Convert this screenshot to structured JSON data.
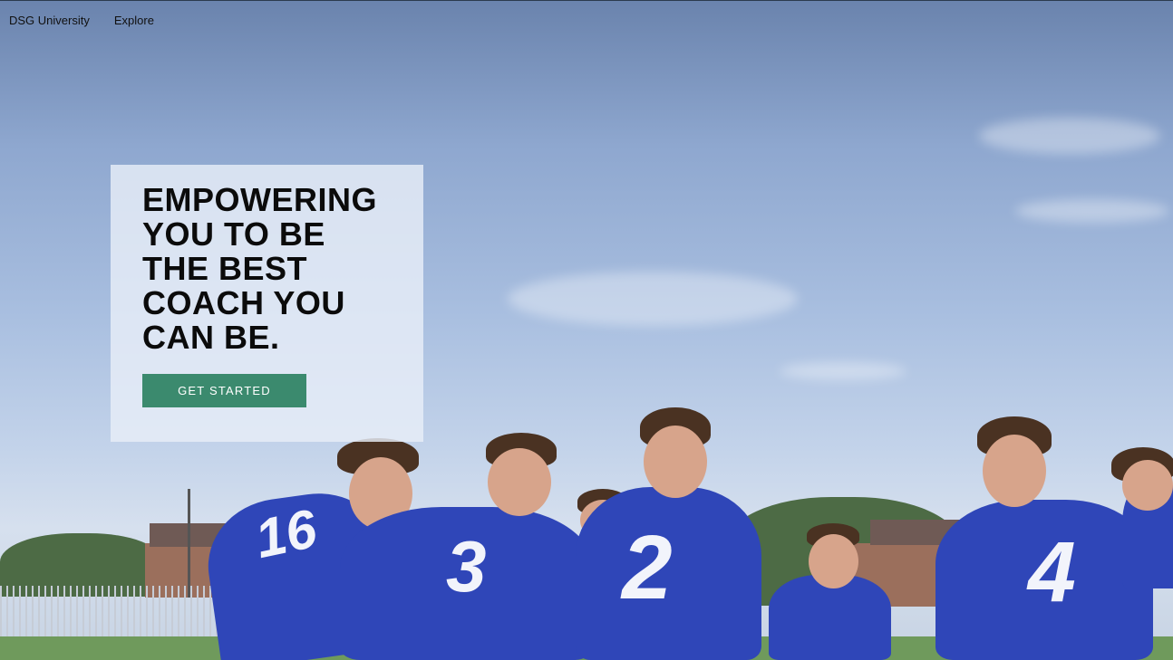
{
  "nav": {
    "brand": "DSG University",
    "explore": "Explore"
  },
  "hero": {
    "headline": "EMPOWERING\nYOU TO BE\nTHE BEST\nCOACH YOU\nCAN BE.",
    "cta_label": "GET STARTED",
    "image": "soccer-team-huddle-photo"
  },
  "jerseys": [
    "16",
    "3",
    "2",
    "4"
  ],
  "colors": {
    "cta": "#3b8a6e",
    "jersey": "#2f46b8",
    "card": "#e8eef8"
  }
}
